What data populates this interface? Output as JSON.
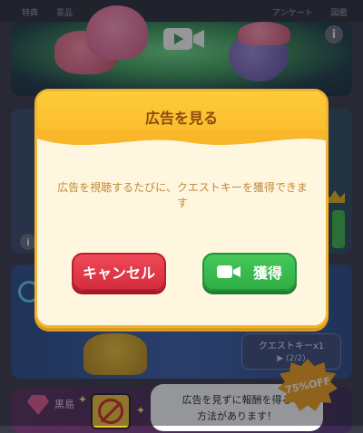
{
  "top_tabs": [
    "特典",
    "景品",
    "アンケート",
    "図鑑"
  ],
  "background": {
    "info_icon": "info-icon",
    "quest_key_button": {
      "label": "クエストキーx1",
      "count": "(2/2)"
    },
    "bottom_item_label": "黒島",
    "tooltip_line1": "広告を見ずに報酬を得る",
    "tooltip_line2": "方法があります！",
    "discount_badge": "75%OFF"
  },
  "modal": {
    "title": "広告を見る",
    "message": "広告を視聴するたびに、クエストキーを獲得できます",
    "cancel_label": "キャンセル",
    "get_label": "獲得",
    "get_icon": "video-camera-icon"
  },
  "colors": {
    "modal_header": "#f8b628",
    "modal_body": "#fff6e0",
    "cancel_button": "#d42c3c",
    "get_button": "#2fae44",
    "title_text": "#8a4a0e"
  }
}
